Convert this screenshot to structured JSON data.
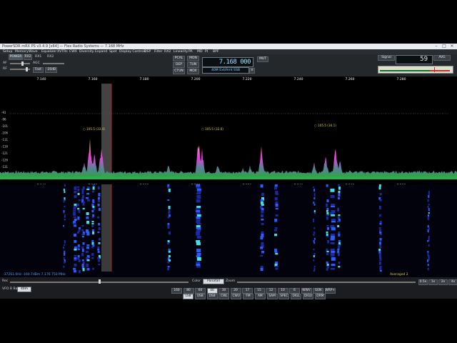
{
  "titlebar": {
    "title": "PowerSDR mRX PS v3.4.9 [x64] — Flex Radio Systems — 7.168 MHz",
    "minimize": "–",
    "maximize": "□",
    "close": "×"
  },
  "menu": [
    "Setup",
    "Memory",
    "Wave",
    "Equalizer",
    "XVTRs",
    "CWX",
    "Diversity",
    "Expand",
    "Spot",
    "Display Controls",
    "DSP",
    "Filter",
    "RX2",
    "Linearity",
    "PA",
    "MD",
    "PI",
    "BPF"
  ],
  "controls": {
    "power": "POWER",
    "rx2": "RX2",
    "rx1_label": "RX1",
    "rx2_label": "RX2",
    "af_label": "AF",
    "rf_label": "RF",
    "agc_label": "AGC",
    "agc_value": "Fast",
    "agc_value2": "-20dB",
    "pcal": "PCAL",
    "mon": "MON",
    "dep": "DEP",
    "tun": "TUN",
    "ctun": "CTUN",
    "mox": "MOX",
    "mut": "MUT",
    "freq": "7.168 000",
    "band_text": "40M Ext/Amt SSB",
    "band_btn": "≡",
    "signal": "Signal",
    "avg": "AVG",
    "meter_value": "59"
  },
  "panorama": {
    "db_labels": [
      "-91",
      "-96",
      "-101",
      "-106",
      "-111",
      "-116",
      "-121",
      "-126",
      "-131",
      "-136"
    ],
    "freq_labels": [
      "7.140",
      "7.160",
      "7.180",
      "7.200",
      "7.220",
      "7.240",
      "7.260",
      "7.280"
    ],
    "spot_labels": [
      "105.5 (33.4)",
      "105.5 (32.6)",
      "105.5 (34.1)"
    ],
    "top_scale_labels": [
      "7.140",
      "7.160",
      "7.180",
      "7.200",
      "7.220",
      "7.240",
      "7.260",
      "7.280"
    ]
  },
  "waterfall_labels": {
    "left": "-37261.0Hz   -160.7dBm   7.176 750 MHz",
    "right": "Averaged 2"
  },
  "bottom": {
    "rec": "Rec",
    "color_label": "Color",
    "color_value": "Panafall",
    "zoom_label": "Zoom",
    "zoom_buttons": [
      "0.5x",
      "1x",
      "2x",
      "4x"
    ],
    "vfo_label": "VFO B Band",
    "vfo_value": "40m",
    "bands": [
      "160",
      "80",
      "60",
      "40",
      "30",
      "20",
      "17",
      "15",
      "12",
      "10",
      "6",
      "WWV",
      "GEN",
      "WRP+"
    ],
    "modes": [
      "LSB",
      "USB",
      "DSB",
      "CWL",
      "CWU",
      "FM",
      "AM",
      "SAM",
      "SPEC",
      "DIGL",
      "DIGU",
      "DRM"
    ],
    "active_band": "40",
    "active_mode": "LSB"
  },
  "colors": {
    "spectrum_fill": "#2bb043",
    "peak": "#ff3df0",
    "frequency": "#9fe0ff",
    "cursor": "#b02020"
  }
}
